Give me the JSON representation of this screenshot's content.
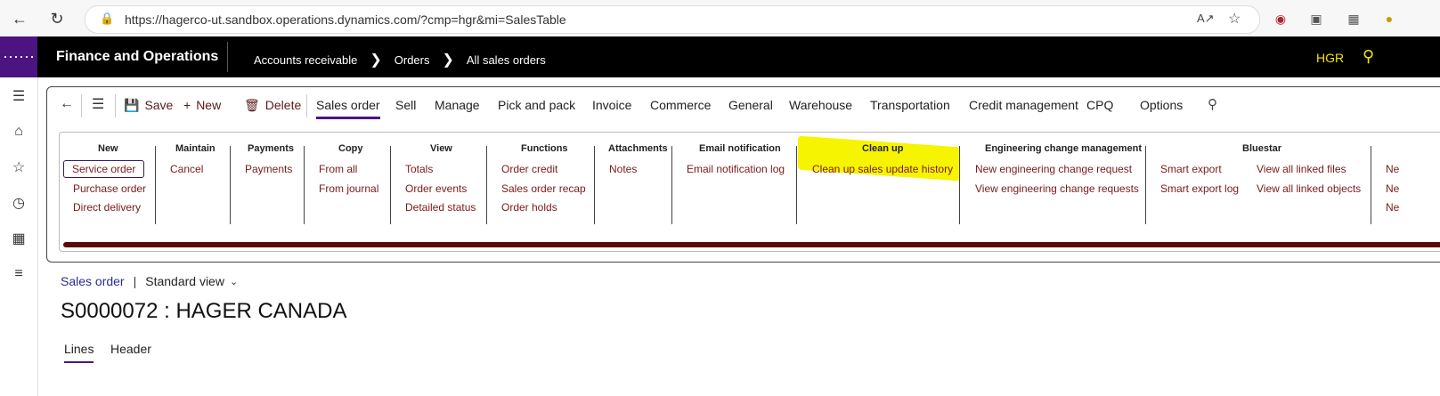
{
  "browser": {
    "url": "https://hagerco-ut.sandbox.operations.dynamics.com/?cmp=hgr&mi=SalesTable"
  },
  "app": {
    "title": "Finance and Operations",
    "breadcrumbs": [
      "Accounts receivable",
      "Orders",
      "All sales orders"
    ],
    "company": "HGR"
  },
  "toolbar": {
    "save": "Save",
    "new": "New",
    "delete": "Delete",
    "tabs": [
      "Sales order",
      "Sell",
      "Manage",
      "Pick and pack",
      "Invoice",
      "Commerce",
      "General",
      "Warehouse",
      "Transportation",
      "Credit management",
      "CPQ",
      "Options"
    ]
  },
  "ribbon": {
    "new": {
      "title": "New",
      "items": [
        "Service order",
        "Purchase order",
        "Direct delivery"
      ]
    },
    "maintain": {
      "title": "Maintain",
      "items": [
        "Cancel"
      ]
    },
    "payments": {
      "title": "Payments",
      "items": [
        "Payments"
      ]
    },
    "copy": {
      "title": "Copy",
      "items": [
        "From all",
        "From journal"
      ]
    },
    "view": {
      "title": "View",
      "items": [
        "Totals",
        "Order events",
        "Detailed status"
      ]
    },
    "functions": {
      "title": "Functions",
      "items": [
        "Order credit",
        "Sales order recap",
        "Order holds"
      ]
    },
    "attachments": {
      "title": "Attachments",
      "items": [
        "Notes"
      ]
    },
    "email": {
      "title": "Email notification",
      "items": [
        "Email notification log"
      ]
    },
    "cleanup": {
      "title": "Clean up",
      "items": [
        "Clean up sales update history"
      ]
    },
    "engineering": {
      "title": "Engineering change management",
      "items": [
        "New engineering change request",
        "View engineering change requests"
      ]
    },
    "bluestar": {
      "title": "Bluestar",
      "items": [
        "Smart export",
        "Smart export log",
        "View all linked files",
        "View all linked objects"
      ]
    },
    "truncated": [
      "Ne",
      "Ne",
      "Ne"
    ]
  },
  "content": {
    "view_link": "Sales order",
    "view_sep": "|",
    "view_name": "Standard view",
    "record_title": "S0000072 : HAGER CANADA",
    "tabs": [
      "Lines",
      "Header"
    ]
  },
  "colors": {
    "accent": "#4b1480",
    "header_bg": "#000000",
    "company_color": "#f5e500",
    "highlight": "#f7f400",
    "ribbon_bar": "#5b0a0a"
  }
}
